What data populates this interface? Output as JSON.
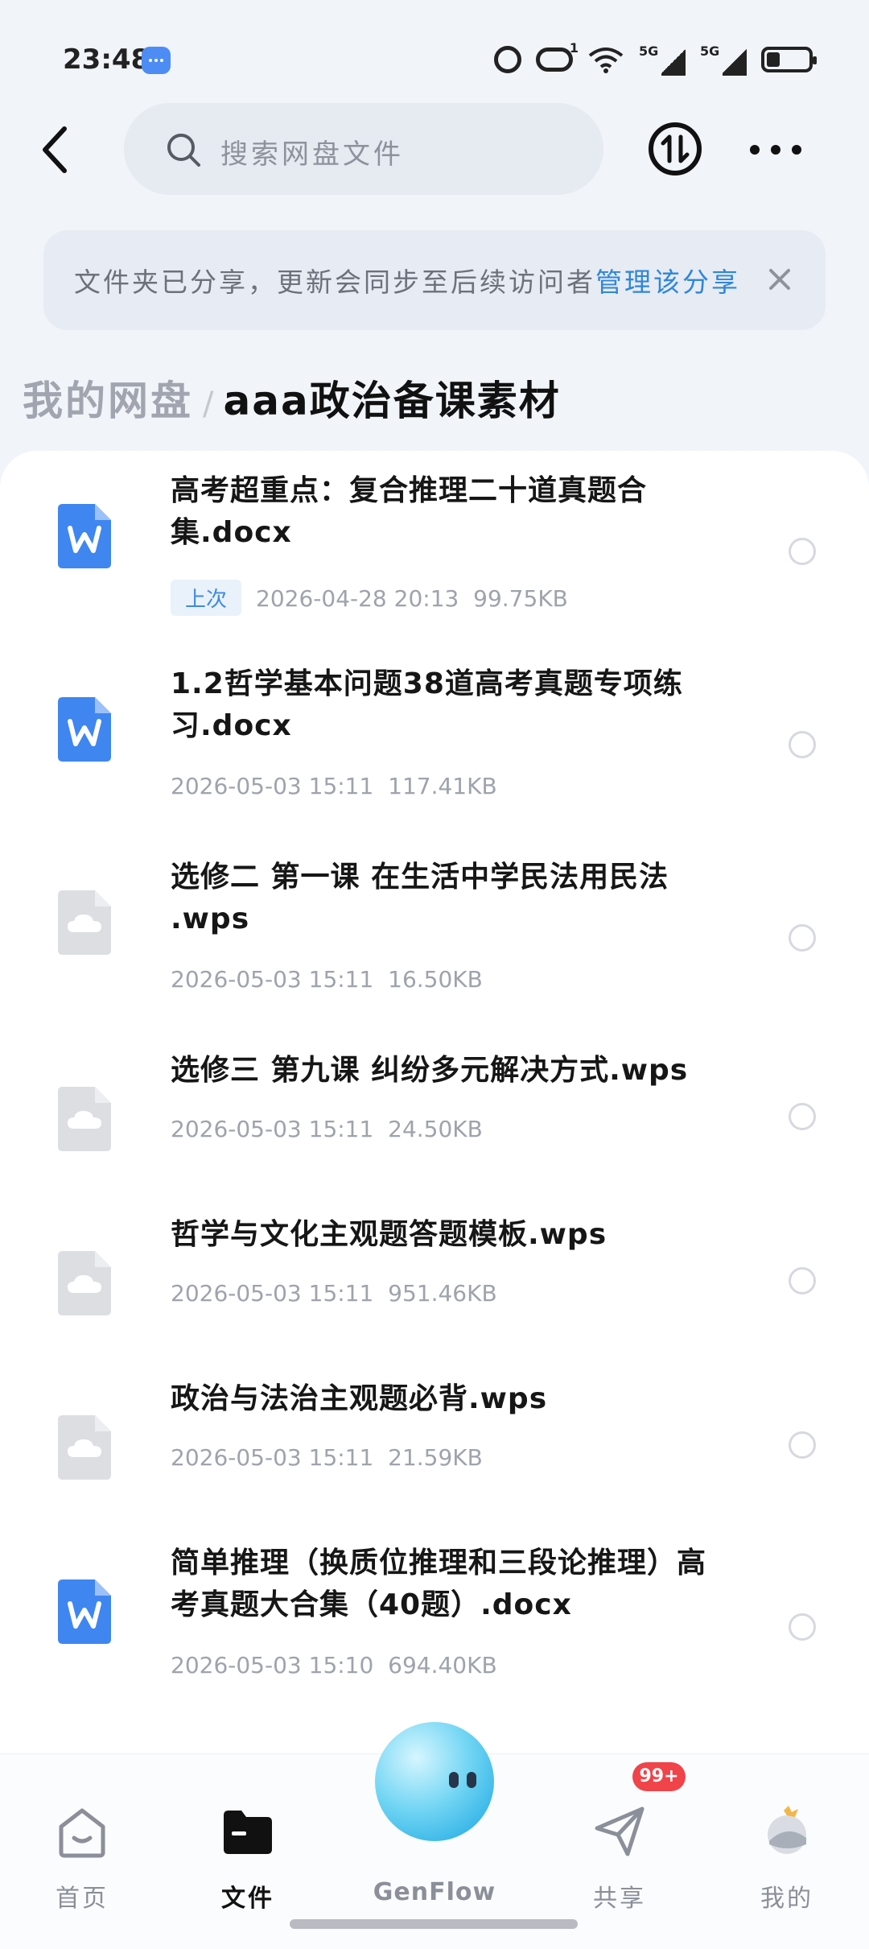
{
  "status_bar": {
    "time": "23:48",
    "sim1_label": "5G",
    "sim2_label": "5G",
    "hotspot_count": "1"
  },
  "header": {
    "search_placeholder": "搜索网盘文件"
  },
  "notice": {
    "text": "文件夹已分享，更新会同步至后续访问者",
    "link": "管理该分享"
  },
  "breadcrumb": {
    "root": "我的网盘",
    "separator": "/",
    "current": "aaa政治备课素材"
  },
  "files": [
    {
      "name": "高考超重点：复合推理二十道真题合集.docx",
      "tag": "上次",
      "date": "2026-04-28 20:13",
      "size": "99.75KB",
      "type": "word"
    },
    {
      "name": "1.2哲学基本问题38道高考真题专项练习.docx",
      "tag": "",
      "date": "2026-05-03 15:11",
      "size": "117.41KB",
      "type": "word"
    },
    {
      "name": "选修二 第一课 在生活中学民法用民法 .wps",
      "tag": "",
      "date": "2026-05-03 15:11",
      "size": "16.50KB",
      "type": "cloud"
    },
    {
      "name": "选修三 第九课 纠纷多元解决方式.wps",
      "tag": "",
      "date": "2026-05-03 15:11",
      "size": "24.50KB",
      "type": "cloud"
    },
    {
      "name": "哲学与文化主观题答题模板.wps",
      "tag": "",
      "date": "2026-05-03 15:11",
      "size": "951.46KB",
      "type": "cloud"
    },
    {
      "name": "政治与法治主观题必背.wps",
      "tag": "",
      "date": "2026-05-03 15:11",
      "size": "21.59KB",
      "type": "cloud"
    },
    {
      "name": "简单推理（换质位推理和三段论推理）高考真题大合集（40题）.docx",
      "tag": "",
      "date": "2026-05-03 15:10",
      "size": "694.40KB",
      "type": "word"
    }
  ],
  "nav": {
    "home": "首页",
    "files": "文件",
    "genflow": "GenFlow",
    "share": "共享",
    "share_badge": "99+",
    "mine": "我的"
  },
  "colors": {
    "accent": "#2f87d9",
    "word_icon": "#3f86f0",
    "badge": "#f0434a"
  }
}
